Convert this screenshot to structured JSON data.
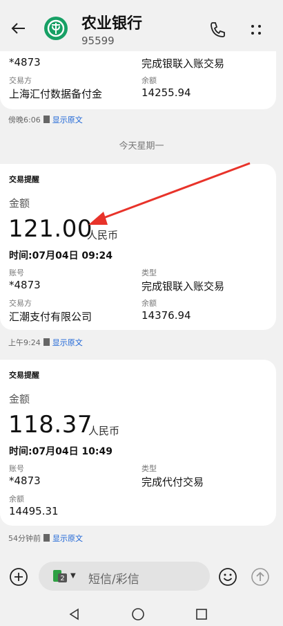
{
  "header": {
    "title": "农业银行",
    "number": "95599"
  },
  "msg0": {
    "type_value": "完成银联入账交易",
    "payer_label": "交易方",
    "payer_value": "上海汇付数据备付金",
    "balance_label": "余额",
    "balance_value": "14255.94",
    "time": "傍晚6:06",
    "account_partial": "*4873",
    "show_original": "显示原文"
  },
  "day_divider": "今天星期一",
  "msg1": {
    "title": "交易提醒",
    "amount_label": "金额",
    "amount": "121.00",
    "unit": "人民币",
    "time_line": "时间:07月04日 09:24",
    "account_label": "账号",
    "account": "*4873",
    "type_label": "类型",
    "type_value": "完成银联入账交易",
    "payer_label": "交易方",
    "payer_value": "汇潮支付有限公司",
    "balance_label": "余额",
    "balance_value": "14376.94",
    "time": "上午9:24",
    "show_original": "显示原文"
  },
  "msg2": {
    "title": "交易提醒",
    "amount_label": "金额",
    "amount": "118.37",
    "unit": "人民币",
    "time_line": "时间:07月04日 10:49",
    "account_label": "账号",
    "account": "*4873",
    "type_label": "类型",
    "type_value": "完成代付交易",
    "balance_label": "余额",
    "balance_value": "14495.31",
    "time": "54分钟前",
    "show_original": "显示原文"
  },
  "input": {
    "placeholder": "短信/彩信",
    "sim": "2"
  },
  "colors": {
    "accent": "#1a63d6",
    "bank_green": "#17a065",
    "annotation": "#e8332a"
  }
}
